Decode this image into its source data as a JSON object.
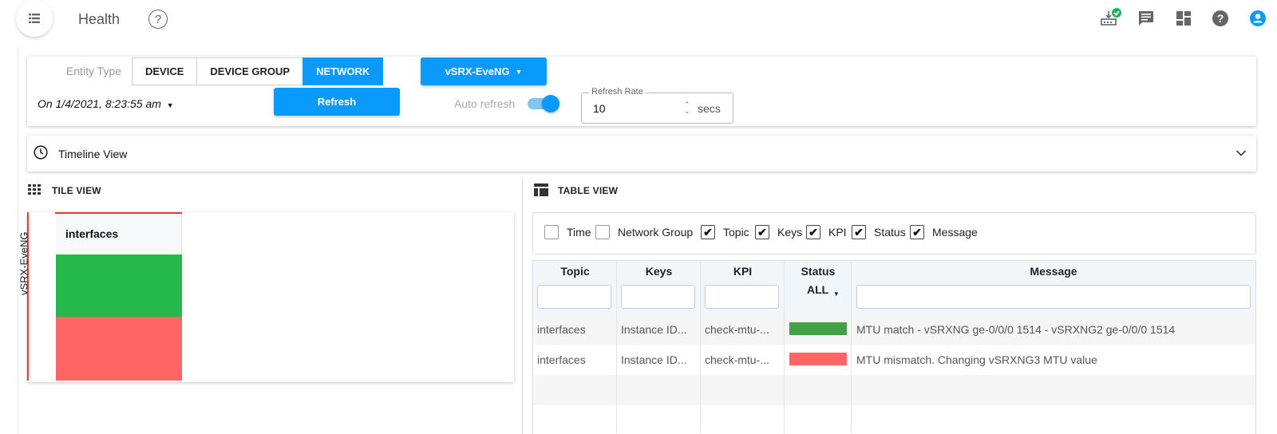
{
  "header": {
    "title": "Health",
    "icons": {
      "menu": "list-icon",
      "help": "question-circle-icon",
      "download": "download-check-icon",
      "messages": "chat-icon",
      "dashboard": "dashboard-icon",
      "support": "help-icon",
      "account": "account-icon"
    }
  },
  "filters": {
    "entity_type_label": "Entity Type",
    "entity_types": [
      "DEVICE",
      "DEVICE GROUP",
      "NETWORK"
    ],
    "selected_entity_type": "NETWORK",
    "entity_select": "vSRX-EveNG",
    "date": "On 1/4/2021, 8:23:55 am",
    "refresh_label": "Refresh",
    "auto_refresh_label": "Auto refresh",
    "auto_refresh_on": true,
    "refresh_rate_label": "Refresh Rate",
    "refresh_rate_value": "10",
    "refresh_rate_unit": "secs"
  },
  "timeline": {
    "label": "Timeline View"
  },
  "tile_view": {
    "header": "TILE VIEW",
    "row_label": "vSRX-EveNG",
    "column_label": "interfaces",
    "colors": {
      "ok": "#24b94a",
      "error": "#ff6565"
    }
  },
  "table_view": {
    "header": "TABLE VIEW",
    "column_options": [
      {
        "label": "Time",
        "checked": false
      },
      {
        "label": "Network Group",
        "checked": false
      },
      {
        "label": "Topic",
        "checked": true
      },
      {
        "label": "Keys",
        "checked": true
      },
      {
        "label": "KPI",
        "checked": true
      },
      {
        "label": "Status",
        "checked": true
      },
      {
        "label": "Message",
        "checked": true
      }
    ],
    "columns": [
      "Topic",
      "Keys",
      "KPI",
      "Status",
      "Message"
    ],
    "status_filter": "ALL",
    "rows": [
      {
        "topic": "interfaces",
        "keys": "Instance ID...",
        "kpi": "check-mtu-...",
        "status_color": "#43a047",
        "message": "MTU match - vSRXNG ge-0/0/0 1514 - vSRXNG2 ge-0/0/0 1514"
      },
      {
        "topic": "interfaces",
        "keys": "Instance ID...",
        "kpi": "check-mtu-...",
        "status_color": "#ff6565",
        "message": "MTU mismatch. Changing vSRXNG3 MTU value"
      }
    ]
  },
  "colors": {
    "accent": "#0a9afc"
  }
}
